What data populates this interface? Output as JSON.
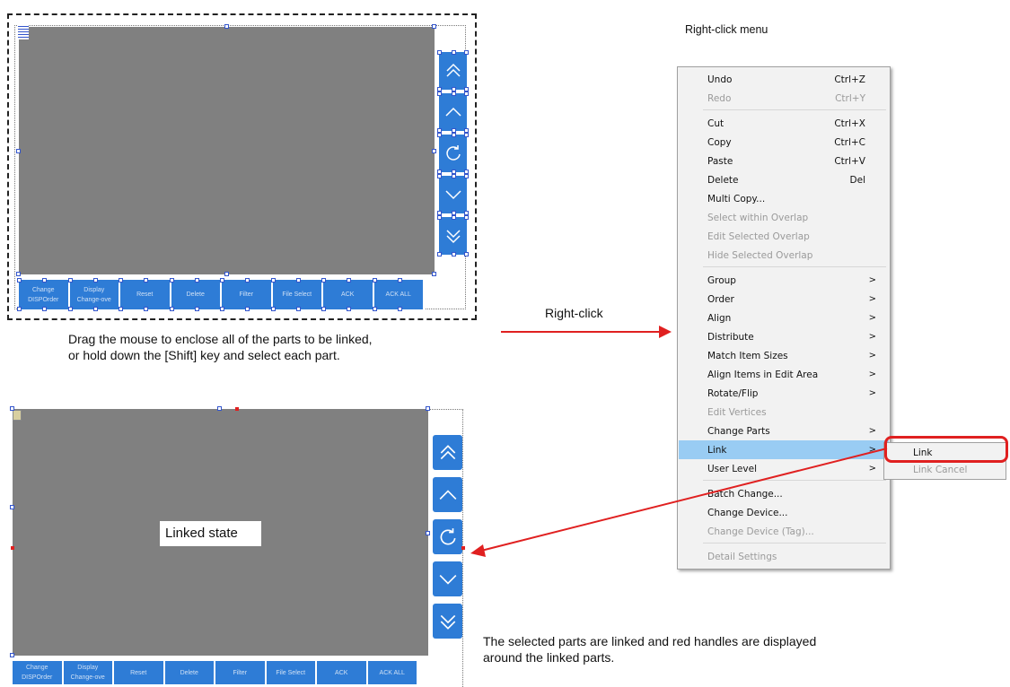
{
  "top_panel": {
    "buttons": [
      {
        "line1": "Change",
        "line2": "DISPOrder"
      },
      {
        "line1": "Display",
        "line2": "Change-ove"
      },
      {
        "line1": "Reset",
        "line2": ""
      },
      {
        "line1": "Delete",
        "line2": ""
      },
      {
        "line1": "Filter",
        "line2": ""
      },
      {
        "line1": "File Select",
        "line2": ""
      },
      {
        "line1": "ACK",
        "line2": ""
      },
      {
        "line1": "ACK ALL",
        "line2": ""
      }
    ],
    "caption_line1": "Drag the mouse to enclose all of the parts to be linked,",
    "caption_line2": "or hold down the [Shift] key and select each part."
  },
  "bottom_panel": {
    "linked_label": "Linked state",
    "buttons": [
      {
        "line1": "Change",
        "line2": "DISPOrder"
      },
      {
        "line1": "Display",
        "line2": "Change-ove"
      },
      {
        "line1": "Reset",
        "line2": ""
      },
      {
        "line1": "Delete",
        "line2": ""
      },
      {
        "line1": "Filter",
        "line2": ""
      },
      {
        "line1": "File Select",
        "line2": ""
      },
      {
        "line1": "ACK",
        "line2": ""
      },
      {
        "line1": "ACK ALL",
        "line2": ""
      }
    ],
    "caption_line1": "The selected parts are linked and red handles are displayed",
    "caption_line2": "around the linked parts."
  },
  "right_click_label": "Right-click",
  "menu_title": "Right-click menu",
  "context_menu": {
    "items": [
      {
        "label": "Undo",
        "shortcut": "Ctrl+Z",
        "disabled": false,
        "arrow": ""
      },
      {
        "label": "Redo",
        "shortcut": "Ctrl+Y",
        "disabled": true,
        "arrow": ""
      },
      {
        "label": "Cut",
        "shortcut": "Ctrl+X",
        "disabled": false,
        "arrow": ""
      },
      {
        "label": "Copy",
        "shortcut": "Ctrl+C",
        "disabled": false,
        "arrow": ""
      },
      {
        "label": "Paste",
        "shortcut": "Ctrl+V",
        "disabled": false,
        "arrow": ""
      },
      {
        "label": "Delete",
        "shortcut": "Del",
        "disabled": false,
        "arrow": ""
      },
      {
        "label": "Multi Copy...",
        "shortcut": "",
        "disabled": false,
        "arrow": ""
      },
      {
        "label": "Select within Overlap",
        "shortcut": "",
        "disabled": true,
        "arrow": ""
      },
      {
        "label": "Edit Selected Overlap",
        "shortcut": "",
        "disabled": true,
        "arrow": ""
      },
      {
        "label": "Hide Selected Overlap",
        "shortcut": "",
        "disabled": true,
        "arrow": ""
      },
      {
        "label": "Group",
        "shortcut": "",
        "disabled": false,
        "arrow": ">"
      },
      {
        "label": "Order",
        "shortcut": "",
        "disabled": false,
        "arrow": ">"
      },
      {
        "label": "Align",
        "shortcut": "",
        "disabled": false,
        "arrow": ">"
      },
      {
        "label": "Distribute",
        "shortcut": "",
        "disabled": false,
        "arrow": ">"
      },
      {
        "label": "Match Item Sizes",
        "shortcut": "",
        "disabled": false,
        "arrow": ">"
      },
      {
        "label": "Align Items in Edit Area",
        "shortcut": "",
        "disabled": false,
        "arrow": ">"
      },
      {
        "label": "Rotate/Flip",
        "shortcut": "",
        "disabled": false,
        "arrow": ">"
      },
      {
        "label": "Edit Vertices",
        "shortcut": "",
        "disabled": true,
        "arrow": ""
      },
      {
        "label": "Change Parts",
        "shortcut": "",
        "disabled": false,
        "arrow": ">"
      },
      {
        "label": "Link",
        "shortcut": "",
        "disabled": false,
        "arrow": ">"
      },
      {
        "label": "User Level",
        "shortcut": "",
        "disabled": false,
        "arrow": ">"
      },
      {
        "label": "Batch Change...",
        "shortcut": "",
        "disabled": false,
        "arrow": ""
      },
      {
        "label": "Change Device...",
        "shortcut": "",
        "disabled": false,
        "arrow": ""
      },
      {
        "label": "Change Device (Tag)...",
        "shortcut": "",
        "disabled": true,
        "arrow": ""
      },
      {
        "label": "Detail Settings",
        "shortcut": "",
        "disabled": true,
        "arrow": ""
      }
    ],
    "highlighted_item": "Link"
  },
  "submenu": {
    "items": [
      {
        "label": "Link",
        "disabled": false
      },
      {
        "label": "Link Cancel",
        "disabled": true
      }
    ]
  },
  "colors": {
    "screen_gray": "#808080",
    "button_blue": "#2e7cd6",
    "highlight_blue": "#99ccf3",
    "annotation_red": "#e02020"
  },
  "icons": {
    "side_buttons": [
      "double-chevron-up-icon",
      "chevron-up-icon",
      "refresh-icon",
      "chevron-down-icon",
      "double-chevron-down-icon"
    ]
  }
}
